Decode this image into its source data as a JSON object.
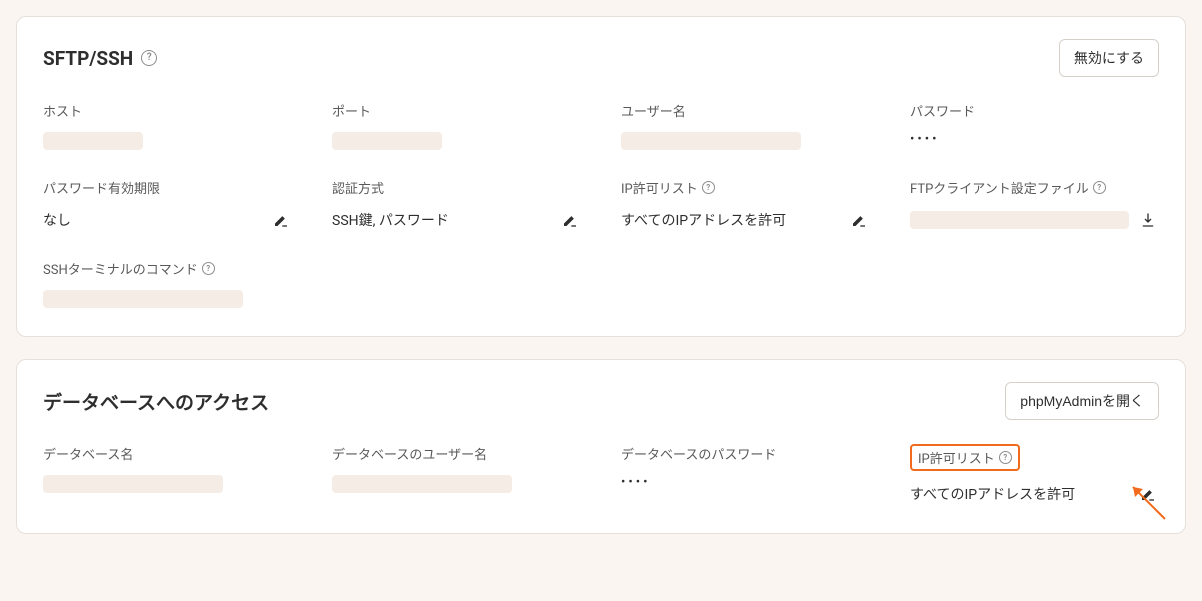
{
  "sftp": {
    "title": "SFTP/SSH",
    "disable_label": "無効にする",
    "fields": {
      "host_label": "ホスト",
      "port_label": "ポート",
      "username_label": "ユーザー名",
      "password_label": "パスワード",
      "password_mask": "••••",
      "expiry_label": "パスワード有効期限",
      "expiry_value": "なし",
      "auth_label": "認証方式",
      "auth_value": "SSH鍵, パスワード",
      "iplist_label": "IP許可リスト",
      "iplist_value": "すべてのIPアドレスを許可",
      "ftpfile_label": "FTPクライアント設定ファイル",
      "sshcmd_label": "SSHターミナルのコマンド"
    }
  },
  "db": {
    "title": "データベースへのアクセス",
    "open_pma_label": "phpMyAdminを開く",
    "fields": {
      "name_label": "データベース名",
      "user_label": "データベースのユーザー名",
      "pass_label": "データベースのパスワード",
      "pass_mask": "••••",
      "iplist_label": "IP許可リスト",
      "iplist_value": "すべてのIPアドレスを許可"
    }
  }
}
